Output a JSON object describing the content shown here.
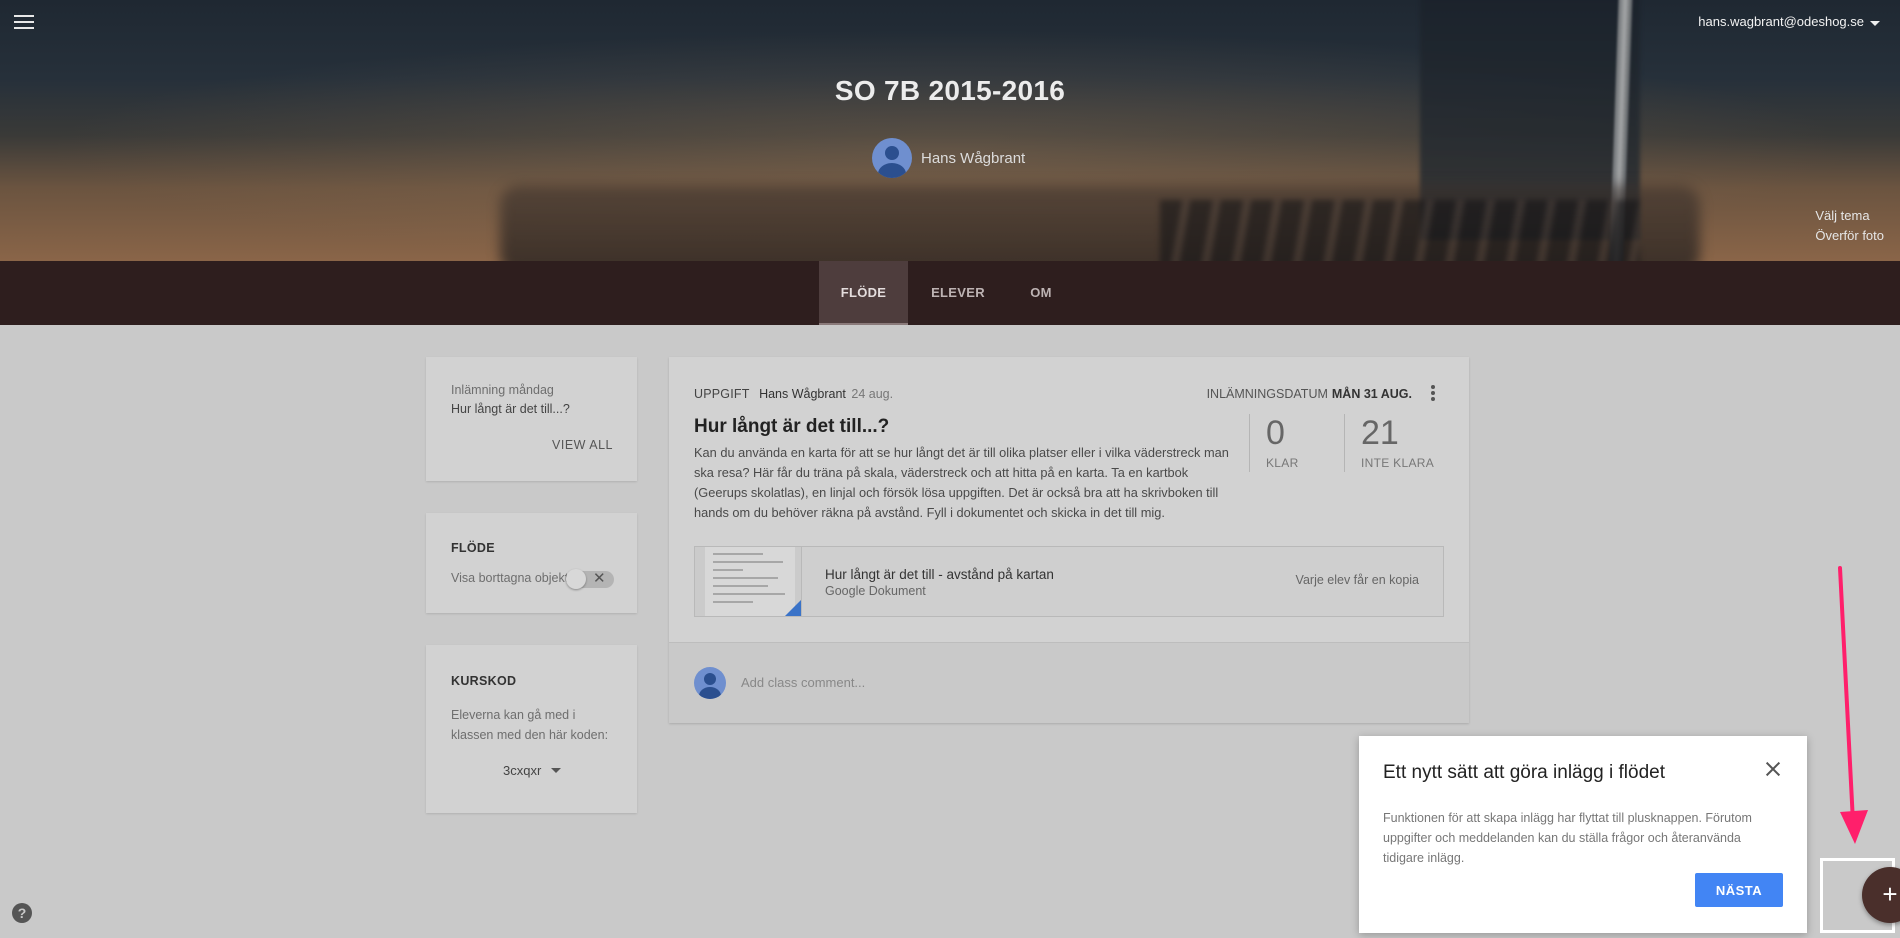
{
  "header": {
    "account_email": "hans.wagbrant@odeshog.se",
    "class_title": "SO 7B 2015-2016",
    "teacher_name": "Hans Wågbrant",
    "theme_links": [
      "Välj tema",
      "Överför foto"
    ]
  },
  "tabs": [
    {
      "label": "FLÖDE",
      "active": true
    },
    {
      "label": "ELEVER",
      "active": false
    },
    {
      "label": "OM",
      "active": false
    }
  ],
  "upcoming": {
    "label": "Inlämning måndag",
    "item": "Hur långt är det till...?",
    "view_all": "VIEW ALL"
  },
  "stream_settings": {
    "heading": "FLÖDE",
    "toggle_label": "Visa borttagna objekt",
    "toggle_on": false
  },
  "class_code": {
    "heading": "KURSKOD",
    "description": "Eleverna kan gå med i klassen med den här koden:",
    "code": "3cxqxr"
  },
  "assignment": {
    "type": "UPPGIFT",
    "author": "Hans Wågbrant",
    "date": "24 aug.",
    "due_label": "INLÄMNINGSDATUM",
    "due_date": "MÅN 31 AUG.",
    "title": "Hur långt är det till...?",
    "description": "Kan du använda en karta för att se hur långt det är till olika platser eller i vilka väderstreck man ska resa? Här får du träna på skala, väderstreck och att hitta på en karta. Ta en kartbok (Geerups skolatlas), en linjal och försök lösa uppgiften. Det är också bra att ha skrivboken till hands om du behöver räkna på avstånd. Fyll i dokumentet och skicka in det till mig.",
    "stats": [
      {
        "value": "0",
        "label": "KLAR"
      },
      {
        "value": "21",
        "label": "INTE KLARA"
      }
    ],
    "attachment": {
      "title": "Hur långt är det till - avstånd på kartan",
      "type": "Google Dokument",
      "sharing": "Varje elev får en kopia"
    },
    "comment_placeholder": "Add class comment..."
  },
  "popup": {
    "title": "Ett nytt sätt att göra inlägg i flödet",
    "body": "Funktionen för att skapa inlägg har flyttat till plusknappen. Förutom uppgifter och meddelanden kan du ställa frågor och återanvända tidigare inlägg.",
    "button": "NÄSTA"
  },
  "fab": {
    "symbol": "+"
  },
  "help": {
    "symbol": "?"
  },
  "colors": {
    "tab_bar": "#2e1e1e",
    "primary_button": "#4285f4",
    "fab": "#4a2f2b",
    "annotation_arrow": "#ff1f6b"
  },
  "icons": [
    "menu-icon",
    "account-dropdown-icon",
    "avatar",
    "more-vert-icon",
    "close-icon",
    "add-icon",
    "help-icon",
    "dropdown-caret-icon",
    "toggle-x-icon",
    "doc-thumbnail"
  ]
}
